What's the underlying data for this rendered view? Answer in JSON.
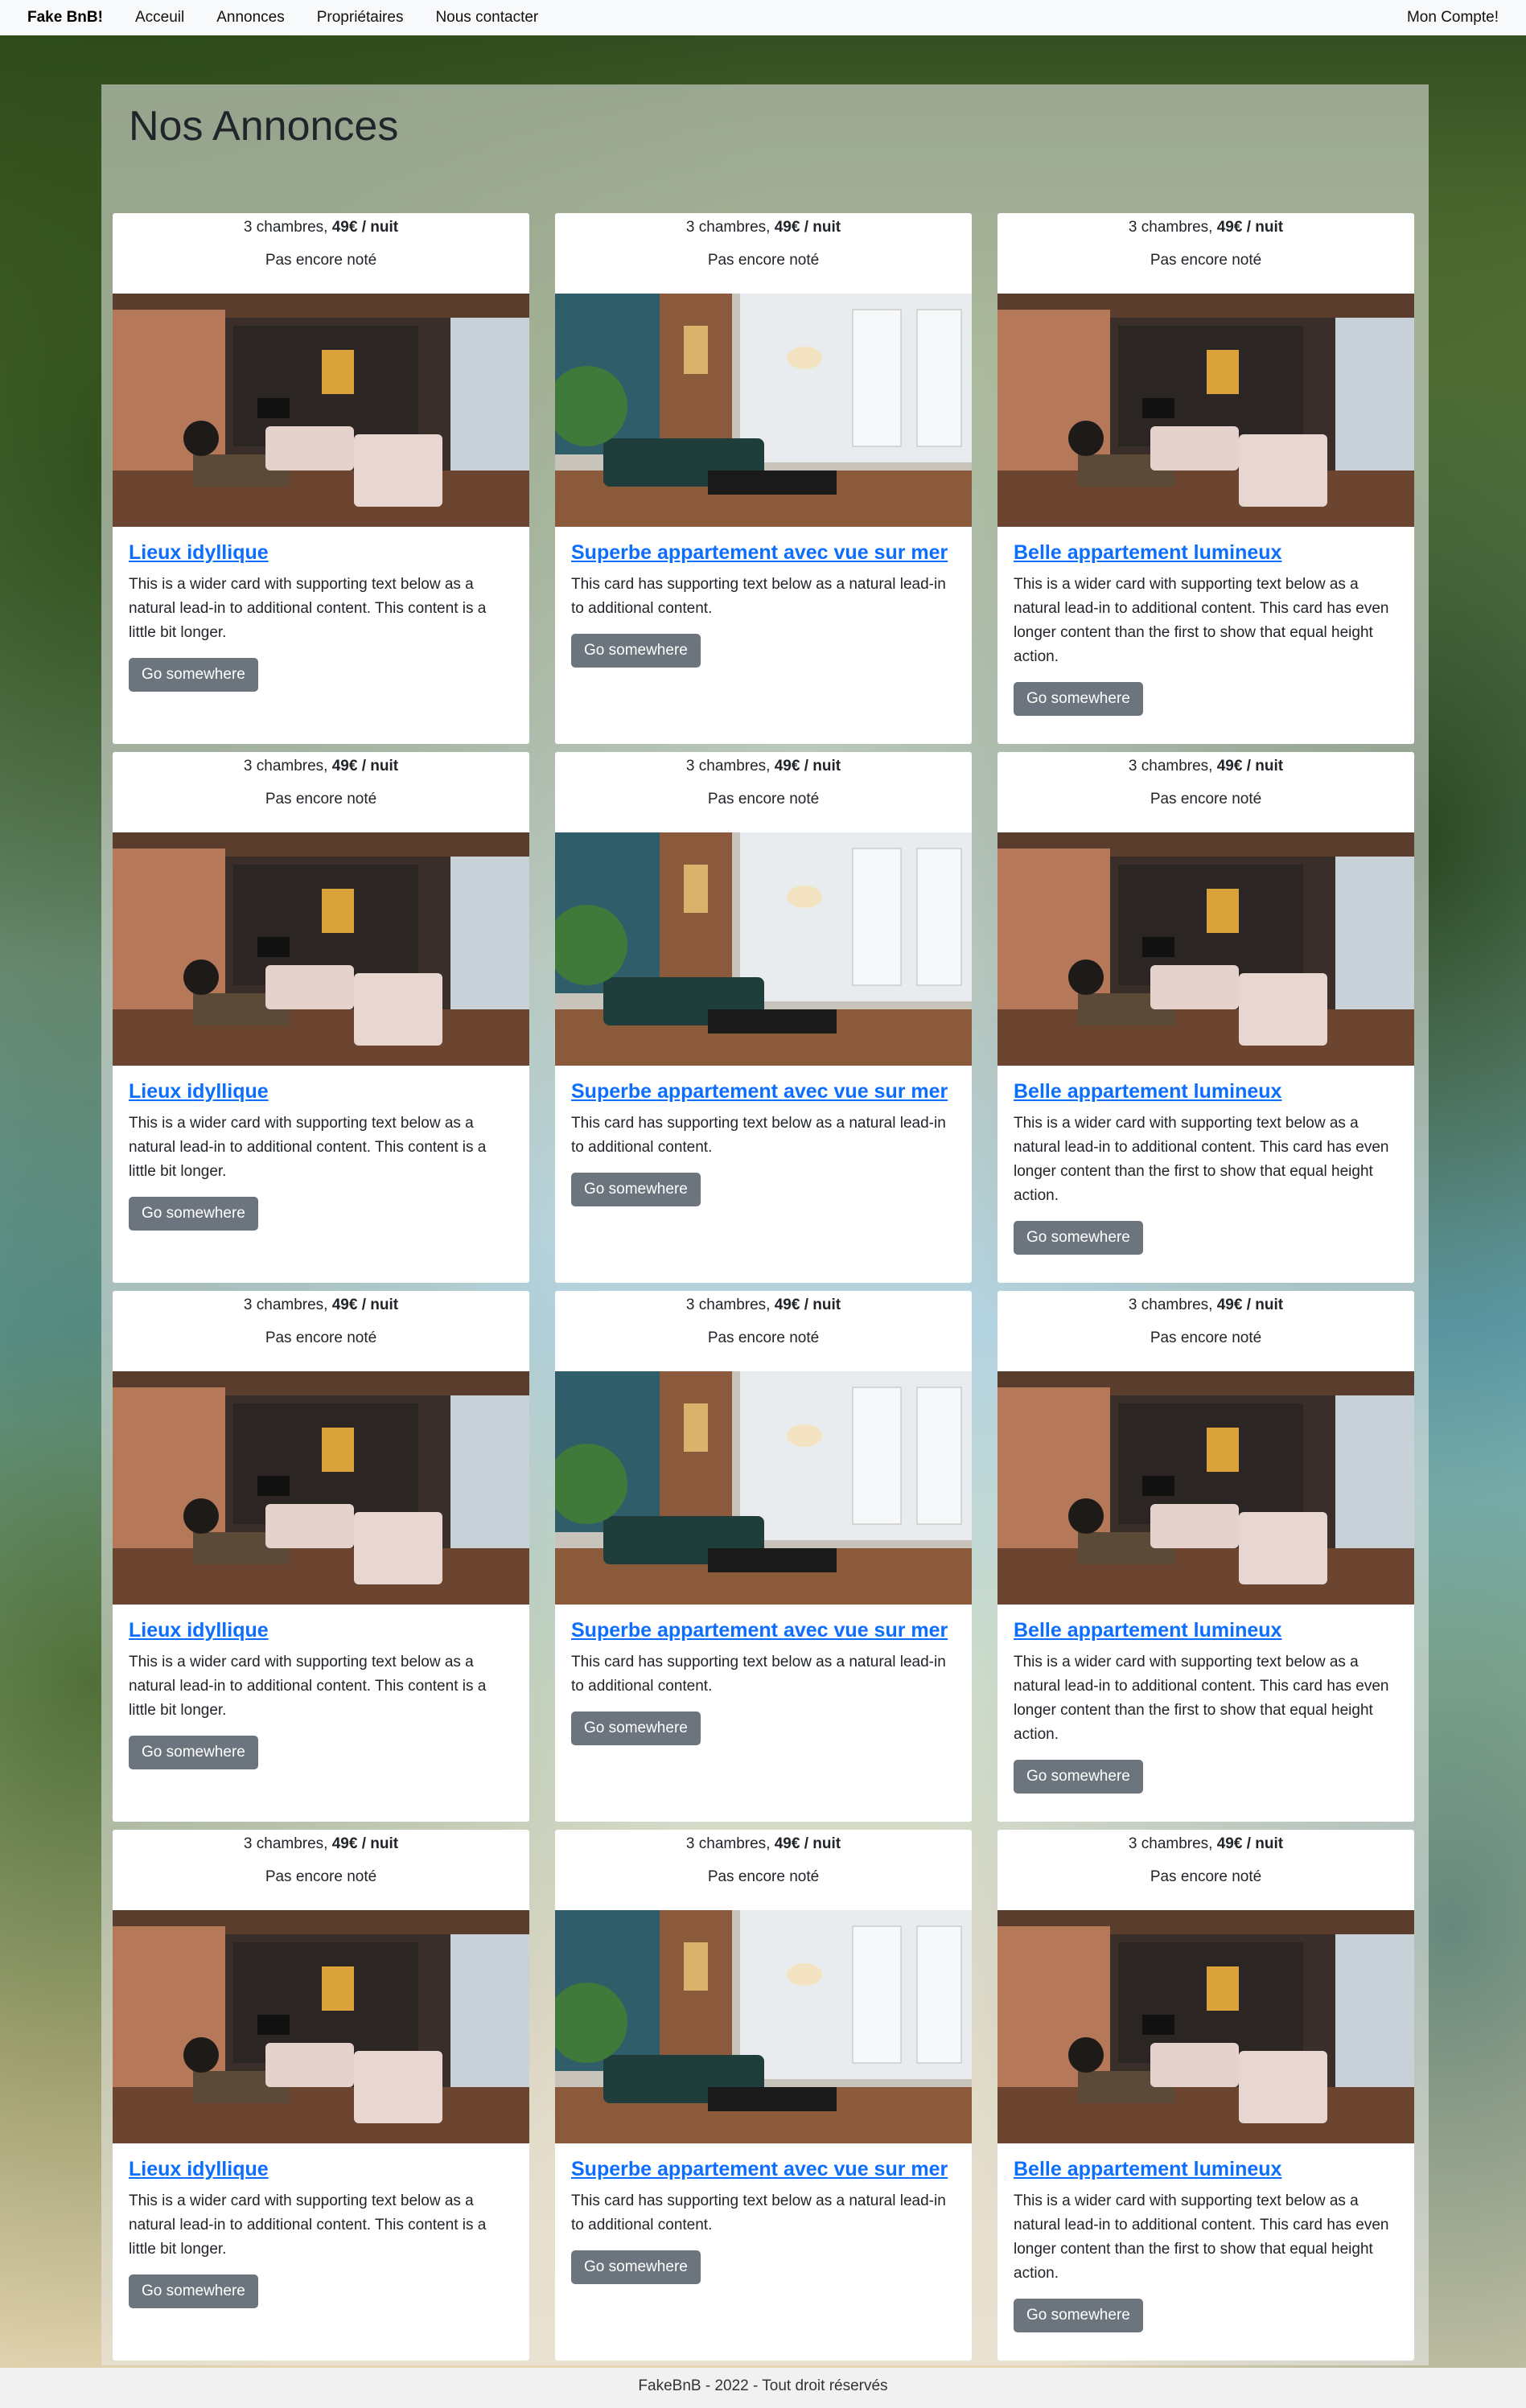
{
  "navbar": {
    "brand": "Fake BnB!",
    "links": [
      "Acceuil",
      "Annonces",
      "Propriétaires",
      "Nous contacter"
    ],
    "account": "Mon Compte!"
  },
  "page": {
    "title": "Nos Annonces"
  },
  "cards": [
    {
      "rooms": "3 chambres, ",
      "price": "49€ / nuit",
      "rating": "Pas encore noté",
      "title": "Lieux idyllique",
      "text": "This is a wider card with supporting text below as a natural lead-in to additional content. This content is a little bit longer.",
      "button": "Go somewhere",
      "image": "living-room-photo-a"
    },
    {
      "rooms": "3 chambres, ",
      "price": "49€ / nuit",
      "rating": "Pas encore noté",
      "title": "Superbe appartement avec vue sur mer",
      "text": "This card has supporting text below as a natural lead-in to additional content.",
      "button": "Go somewhere",
      "image": "living-room-photo-b"
    },
    {
      "rooms": "3 chambres, ",
      "price": "49€ / nuit",
      "rating": "Pas encore noté",
      "title": "Belle appartement lumineux",
      "text": "This is a wider card with supporting text below as a natural lead-in to additional content. This card has even longer content than the first to show that equal height action.",
      "button": "Go somewhere",
      "image": "living-room-photo-a"
    },
    {
      "rooms": "3 chambres, ",
      "price": "49€ / nuit",
      "rating": "Pas encore noté",
      "title": "Lieux idyllique",
      "text": "This is a wider card with supporting text below as a natural lead-in to additional content. This content is a little bit longer.",
      "button": "Go somewhere",
      "image": "living-room-photo-a"
    },
    {
      "rooms": "3 chambres, ",
      "price": "49€ / nuit",
      "rating": "Pas encore noté",
      "title": "Superbe appartement avec vue sur mer",
      "text": "This card has supporting text below as a natural lead-in to additional content.",
      "button": "Go somewhere",
      "image": "living-room-photo-b"
    },
    {
      "rooms": "3 chambres, ",
      "price": "49€ / nuit",
      "rating": "Pas encore noté",
      "title": "Belle appartement lumineux",
      "text": "This is a wider card with supporting text below as a natural lead-in to additional content. This card has even longer content than the first to show that equal height action.",
      "button": "Go somewhere",
      "image": "living-room-photo-a"
    },
    {
      "rooms": "3 chambres, ",
      "price": "49€ / nuit",
      "rating": "Pas encore noté",
      "title": "Lieux idyllique",
      "text": "This is a wider card with supporting text below as a natural lead-in to additional content. This content is a little bit longer.",
      "button": "Go somewhere",
      "image": "living-room-photo-a"
    },
    {
      "rooms": "3 chambres, ",
      "price": "49€ / nuit",
      "rating": "Pas encore noté",
      "title": "Superbe appartement avec vue sur mer",
      "text": "This card has supporting text below as a natural lead-in to additional content.",
      "button": "Go somewhere",
      "image": "living-room-photo-b"
    },
    {
      "rooms": "3 chambres, ",
      "price": "49€ / nuit",
      "rating": "Pas encore noté",
      "title": "Belle appartement lumineux",
      "text": "This is a wider card with supporting text below as a natural lead-in to additional content. This card has even longer content than the first to show that equal height action.",
      "button": "Go somewhere",
      "image": "living-room-photo-a"
    },
    {
      "rooms": "3 chambres, ",
      "price": "49€ / nuit",
      "rating": "Pas encore noté",
      "title": "Lieux idyllique",
      "text": "This is a wider card with supporting text below as a natural lead-in to additional content. This content is a little bit longer.",
      "button": "Go somewhere",
      "image": "living-room-photo-a"
    },
    {
      "rooms": "3 chambres, ",
      "price": "49€ / nuit",
      "rating": "Pas encore noté",
      "title": "Superbe appartement avec vue sur mer",
      "text": "This card has supporting text below as a natural lead-in to additional content.",
      "button": "Go somewhere",
      "image": "living-room-photo-b"
    },
    {
      "rooms": "3 chambres, ",
      "price": "49€ / nuit",
      "rating": "Pas encore noté",
      "title": "Belle appartement lumineux",
      "text": "This is a wider card with supporting text below as a natural lead-in to additional content. This card has even longer content than the first to show that equal height action.",
      "button": "Go somewhere",
      "image": "living-room-photo-a"
    }
  ],
  "footer": {
    "text": "FakeBnB - 2022 - Tout droit réservés"
  },
  "colors": {
    "link": "#0d6efd",
    "button": "#6c757d",
    "navbar": "#f8f9fa"
  }
}
